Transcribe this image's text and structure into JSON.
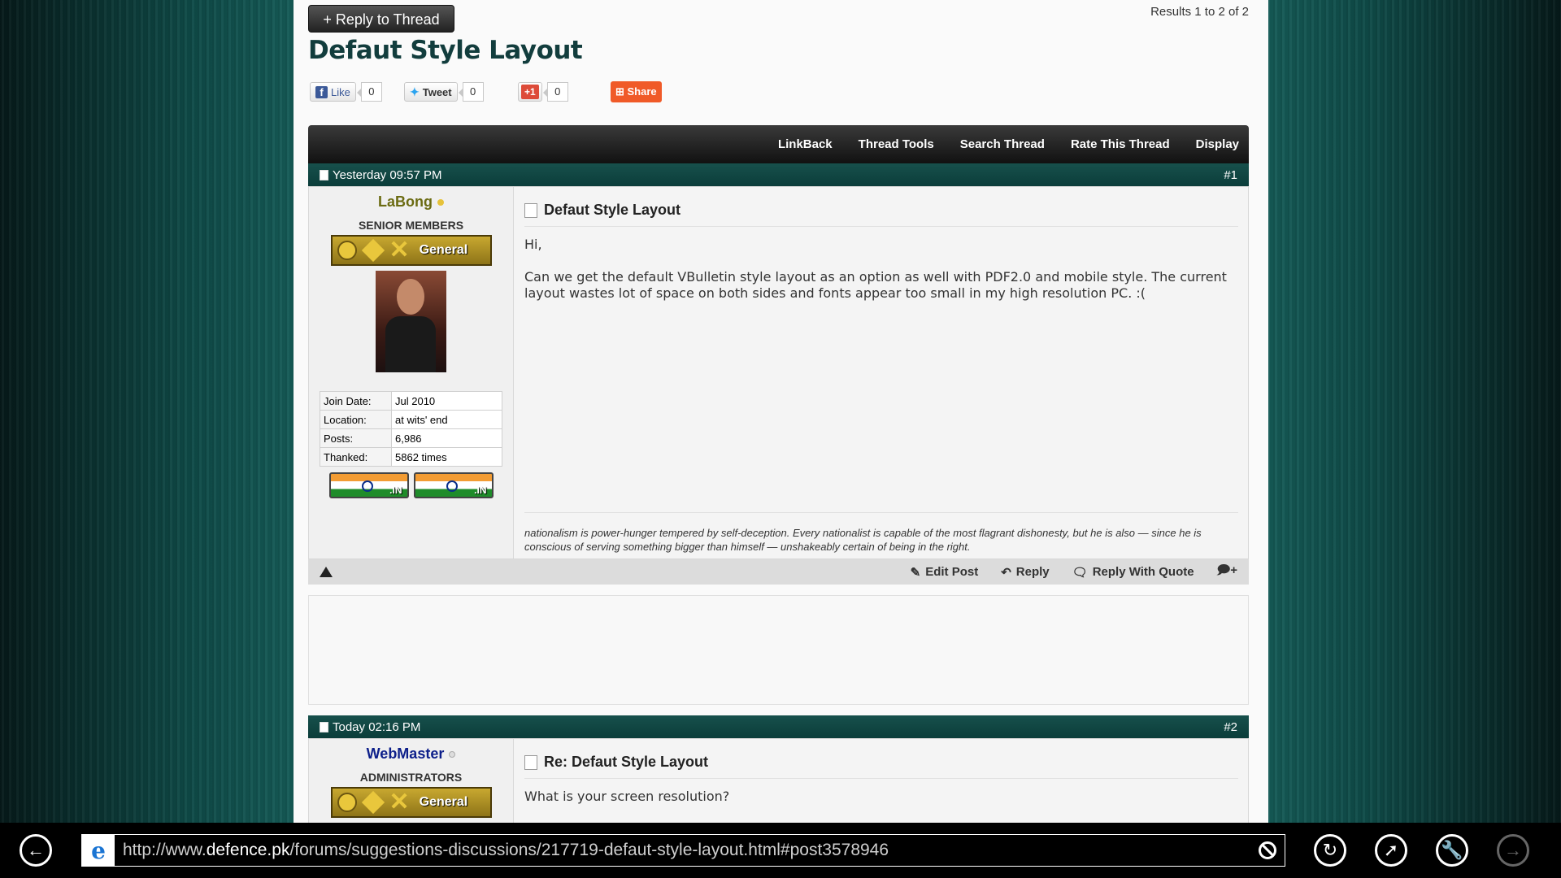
{
  "thread": {
    "reply_label": "+ Reply to Thread",
    "results": "Results 1 to 2 of 2",
    "title": "Defaut Style Layout"
  },
  "social": {
    "like_label": "Like",
    "like_count": "0",
    "tweet_label": "Tweet",
    "tweet_count": "0",
    "gplus_label": "+1",
    "gplus_count": "0",
    "share_label": "Share"
  },
  "toolbar": [
    "LinkBack",
    "Thread Tools",
    "Search Thread",
    "Rate This Thread",
    "Display"
  ],
  "posts": [
    {
      "date": "Yesterday 09:57 PM",
      "num": "#1",
      "username": "LaBong",
      "username_color": "#6b6b12",
      "usertitle": "SENIOR MEMBERS",
      "rank_label": "General",
      "stats": [
        {
          "k": "Join Date:",
          "v": "Jul 2010"
        },
        {
          "k": "Location:",
          "v": "at wits' end"
        },
        {
          "k": "Posts:",
          "v": "6,986"
        },
        {
          "k": "Thanked:",
          "v": "5862 times"
        }
      ],
      "flag_label": ".IN",
      "title": "Defaut Style Layout",
      "body": [
        "Hi,",
        "Can we get the default VBulletin style layout as an option as well with PDF2.0 and mobile style. The current layout wastes lot of space on both sides and fonts appear too small in my high resolution PC. :("
      ],
      "signature": "nationalism is power-hunger tempered by self-deception. Every nationalist is capable of the most flagrant dishonesty, but he is also — since he is conscious of serving something bigger than himself — unshakeably certain of being in the right."
    },
    {
      "date": "Today 02:16 PM",
      "num": "#2",
      "username": "WebMaster",
      "username_color": "#0d1f8a",
      "usertitle": "ADMINISTRATORS",
      "rank_label": "General",
      "title": "Re: Defaut Style Layout",
      "body": [
        "What is your screen resolution?"
      ]
    }
  ],
  "post_actions": {
    "edit": "Edit Post",
    "reply": "Reply",
    "quote": "Reply With Quote"
  },
  "browser": {
    "url_prefix": "http://www.",
    "url_host": "defence.pk",
    "url_path": "/forums/suggestions-discussions/217719-defaut-style-layout.html#post3578946"
  }
}
